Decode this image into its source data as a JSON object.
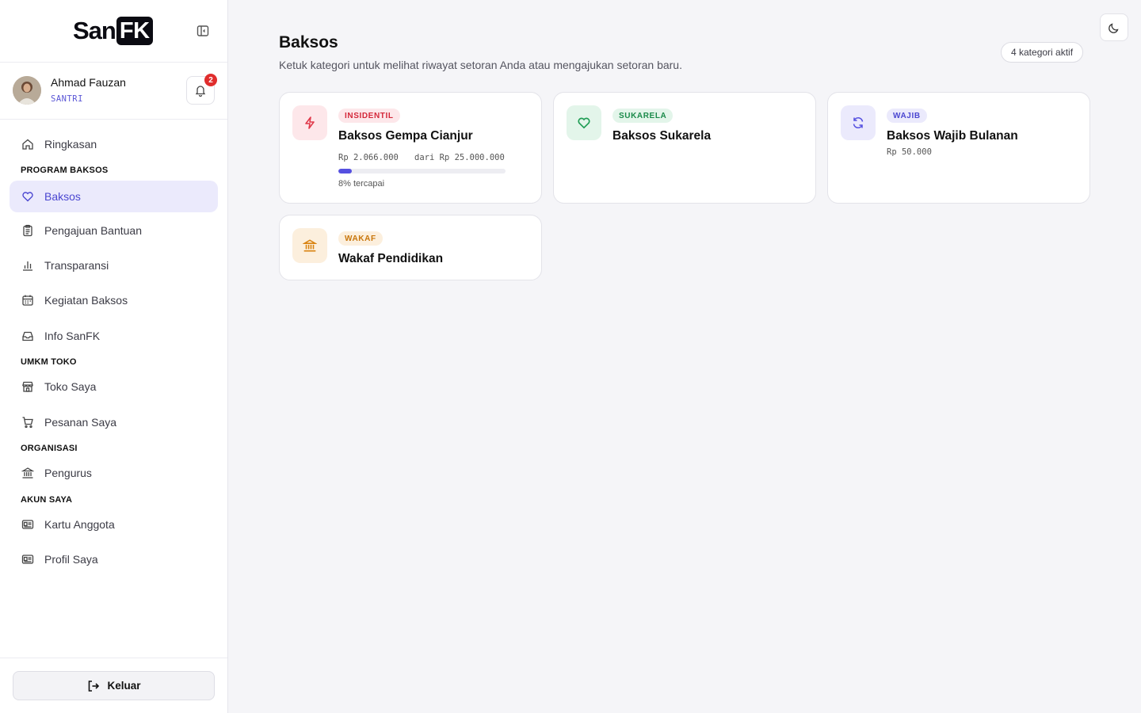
{
  "sidebar": {
    "logo": {
      "left": "San",
      "right": "FK"
    },
    "user": {
      "name": "Ahmad Fauzan",
      "role": "SANTRI",
      "notifications": "2"
    },
    "nav": {
      "ringkasan": "Ringkasan",
      "section_program": "PROGRAM BAKSOS",
      "baksos": "Baksos",
      "pengajuan": "Pengajuan Bantuan",
      "transparansi": "Transparansi",
      "kegiatan": "Kegiatan Baksos",
      "info": "Info SanFK",
      "section_umkm": "UMKM TOKO",
      "toko": "Toko Saya",
      "pesanan": "Pesanan Saya",
      "section_org": "ORGANISASI",
      "pengurus": "Pengurus",
      "section_akun": "AKUN SAYA",
      "kartu": "Kartu Anggota",
      "profil": "Profil Saya"
    },
    "logout": "Keluar"
  },
  "main": {
    "title": "Baksos",
    "subtitle": "Ketuk kategori untuk melihat riwayat setoran Anda atau mengajukan setoran baru.",
    "count_pill": "4 kategori aktif",
    "cards": [
      {
        "tag": "INSIDENTIL",
        "title": "Baksos Gempa Cianjur",
        "amount": "Rp 2.066.000",
        "target": "dari Rp 25.000.000",
        "progress": 0.08,
        "progress_label": "8% tercapai",
        "icon": "bolt-icon",
        "color": "#e0394a"
      },
      {
        "tag": "SUKARELA",
        "title": "Baksos Sukarela",
        "icon": "heart-icon",
        "color": "#1f9d55"
      },
      {
        "tag": "WAJIB",
        "title": "Baksos Wajib Bulanan",
        "amount": "Rp 50.000",
        "icon": "refresh-icon",
        "color": "#5550e0"
      },
      {
        "tag": "WAKAF",
        "title": "Wakaf Pendidikan",
        "icon": "bank-icon",
        "color": "#d9820f"
      }
    ]
  },
  "colors": {
    "accent": "#5550e0",
    "active_bg": "#ebeafc",
    "badge": "#e02d2d"
  }
}
